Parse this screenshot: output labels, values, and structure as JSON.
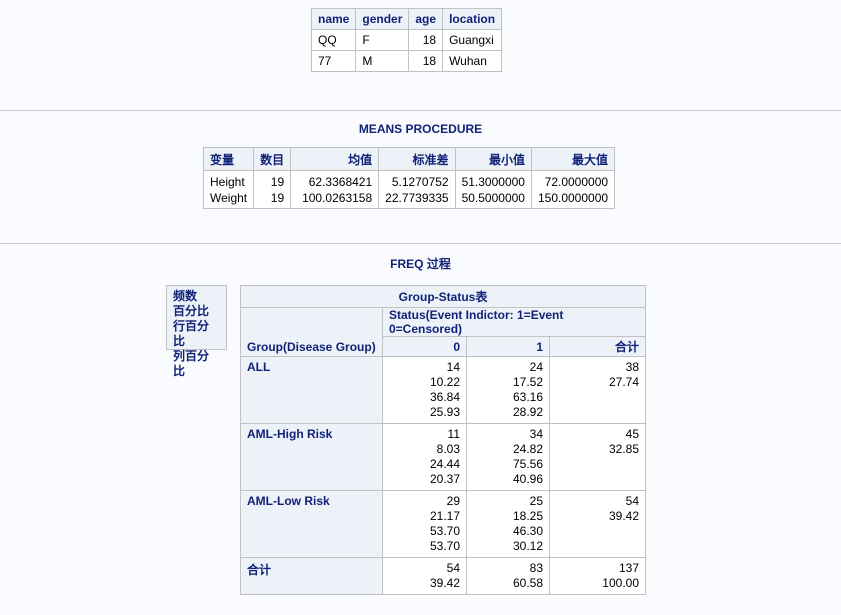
{
  "table1": {
    "headers": [
      "name",
      "gender",
      "age",
      "location"
    ],
    "rows": [
      [
        "QQ",
        "F",
        "18",
        "Guangxi"
      ],
      [
        "77",
        "M",
        "18",
        "Wuhan"
      ]
    ]
  },
  "means": {
    "title": "MEANS PROCEDURE",
    "headers": [
      "变量",
      "数目",
      "均值",
      "标准差",
      "最小值",
      "最大值"
    ],
    "rows": [
      [
        "Height",
        "19",
        "62.3368421",
        "5.1270752",
        "51.3000000",
        "72.0000000"
      ],
      [
        "Weight",
        "19",
        "100.0263158",
        "22.7739335",
        "50.5000000",
        "150.0000000"
      ]
    ]
  },
  "freq": {
    "title": "FREQ 过程",
    "legend": [
      "频数",
      "百分比",
      "行百分比",
      "列百分比"
    ],
    "table_title": "Group-Status表",
    "status_header": "Status(Event Indictor: 1=Event 0=Censored)",
    "row_var": "Group(Disease Group)",
    "col_labels": [
      "0",
      "1",
      "合计"
    ],
    "rows": [
      {
        "label": "ALL",
        "c0": [
          "14",
          "10.22",
          "36.84",
          "25.93"
        ],
        "c1": [
          "24",
          "17.52",
          "63.16",
          "28.92"
        ],
        "c2": [
          "38",
          "27.74"
        ]
      },
      {
        "label": "AML-High Risk",
        "c0": [
          "11",
          "8.03",
          "24.44",
          "20.37"
        ],
        "c1": [
          "34",
          "24.82",
          "75.56",
          "40.96"
        ],
        "c2": [
          "45",
          "32.85"
        ]
      },
      {
        "label": "AML-Low Risk",
        "c0": [
          "29",
          "21.17",
          "53.70",
          "53.70"
        ],
        "c1": [
          "25",
          "18.25",
          "46.30",
          "30.12"
        ],
        "c2": [
          "54",
          "39.42"
        ]
      },
      {
        "label": "合计",
        "c0": [
          "54",
          "39.42"
        ],
        "c1": [
          "83",
          "60.58"
        ],
        "c2": [
          "137",
          "100.00"
        ]
      }
    ]
  }
}
